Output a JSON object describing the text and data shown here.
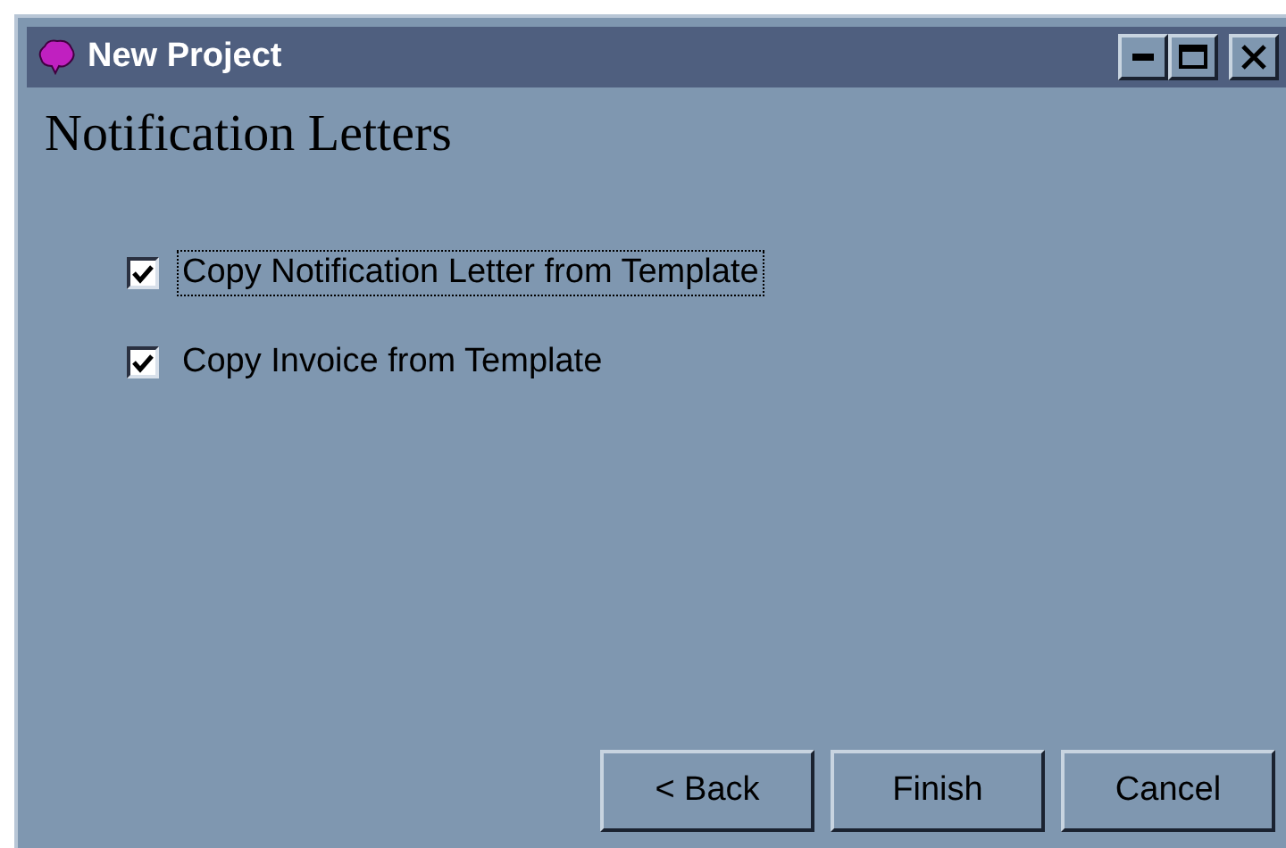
{
  "window": {
    "title": "New Project"
  },
  "heading": "Notification Letters",
  "options": [
    {
      "label": "Copy Notification Letter from Template",
      "checked": true,
      "focused": true
    },
    {
      "label": "Copy Invoice from Template",
      "checked": true,
      "focused": false
    }
  ],
  "buttons": [
    {
      "label": "< Back"
    },
    {
      "label": "Finish"
    },
    {
      "label": "Cancel"
    }
  ]
}
